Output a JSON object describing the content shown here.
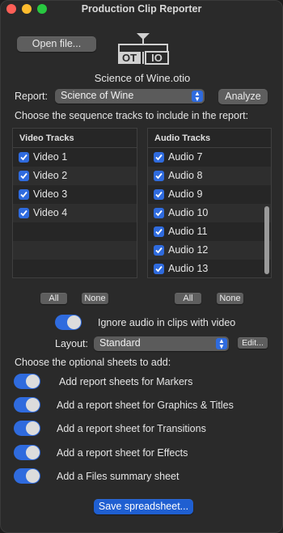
{
  "window": {
    "title": "Production Clip Reporter"
  },
  "toolbar": {
    "open_file": "Open file...",
    "analyze": "Analyze"
  },
  "logo": {
    "left": "OT",
    "right": "IO"
  },
  "file_name": "Science of Wine.otio",
  "report": {
    "label": "Report:",
    "selected": "Science of Wine"
  },
  "tracks_instruction": "Choose the sequence tracks to include in the report:",
  "video_tracks": {
    "header": "Video Tracks",
    "items": [
      {
        "label": "Video 1",
        "checked": true
      },
      {
        "label": "Video 2",
        "checked": true
      },
      {
        "label": "Video 3",
        "checked": true
      },
      {
        "label": "Video 4",
        "checked": true
      }
    ],
    "all": "All",
    "none": "None"
  },
  "audio_tracks": {
    "header": "Audio Tracks",
    "items": [
      {
        "label": "Audio 7",
        "checked": true
      },
      {
        "label": "Audio 8",
        "checked": true
      },
      {
        "label": "Audio 9",
        "checked": true
      },
      {
        "label": "Audio 10",
        "checked": true
      },
      {
        "label": "Audio 11",
        "checked": true
      },
      {
        "label": "Audio 12",
        "checked": true
      },
      {
        "label": "Audio 13",
        "checked": true
      }
    ],
    "all": "All",
    "none": "None"
  },
  "ignore_audio": {
    "label": "Ignore audio in clips with video",
    "on": true
  },
  "layout": {
    "label": "Layout:",
    "selected": "Standard",
    "edit": "Edit..."
  },
  "sheets_instruction": "Choose the optional sheets to add:",
  "sheets": [
    {
      "label": "Add report sheets for Markers",
      "on": true
    },
    {
      "label": "Add a report sheet for Graphics & Titles",
      "on": true
    },
    {
      "label": "Add a report sheet for Transitions",
      "on": true
    },
    {
      "label": "Add a report sheet for Effects",
      "on": true
    },
    {
      "label": "Add a Files summary sheet",
      "on": true
    }
  ],
  "save_button": "Save spreadsheet...",
  "colors": {
    "accent": "#2f6bde",
    "window_bg": "#2a2a2a"
  }
}
